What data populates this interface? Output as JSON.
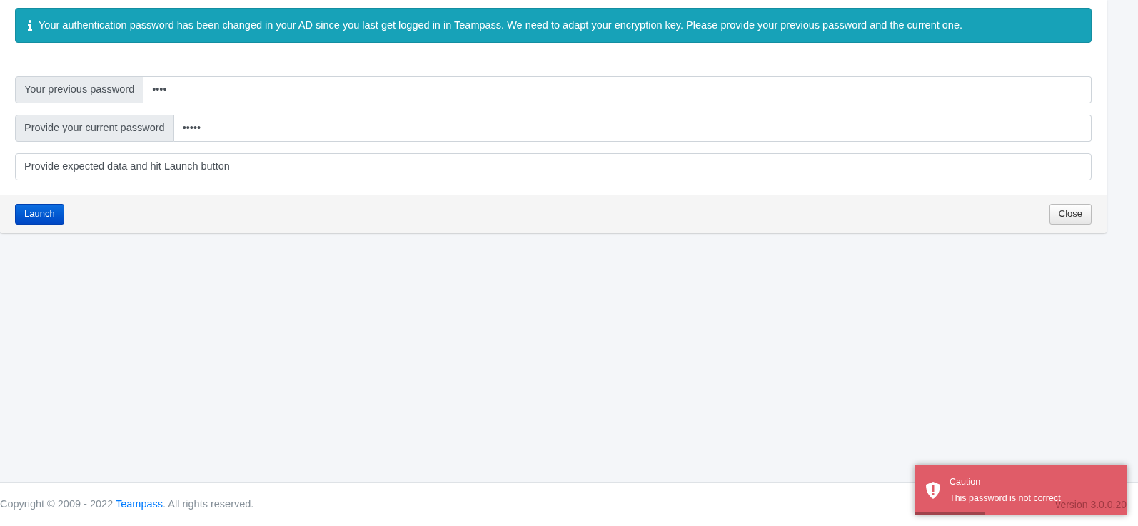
{
  "alert": {
    "kind": "info",
    "text": "Your authentication password has been changed in your AD since you last get logged in in Teampass. We need to adapt your encryption key. Please provide your previous password and the current one."
  },
  "fields": [
    {
      "label": "Your previous password",
      "value": "••••"
    },
    {
      "label": "Provide your current password",
      "value": "•••••"
    },
    {
      "value": "Provide expected data and hit Launch button"
    }
  ],
  "buttons": {
    "launch": "Launch",
    "close": "Close"
  },
  "footer": {
    "prefix": "Copyright © 2009 - 2022 ",
    "link": "Teampass",
    "suffix": ". All rights reserved.",
    "version": "version 3.0.0.20"
  },
  "toast": {
    "kind": "error",
    "title": "Caution",
    "message": "This password is not correct",
    "level": 0.33
  }
}
